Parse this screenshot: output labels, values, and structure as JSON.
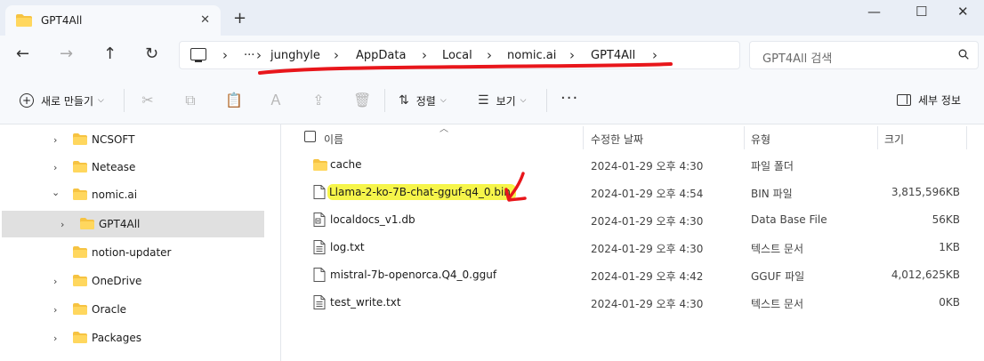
{
  "tab": {
    "title": "GPT4All",
    "close": "✕",
    "new_tab": "+"
  },
  "window_controls": {
    "minimize": "—",
    "maximize": "☐",
    "close": "✕"
  },
  "nav": {
    "back": "←",
    "forward": "→",
    "up": "↑",
    "refresh": "↻"
  },
  "address": {
    "more": "···",
    "separator": "›",
    "crumbs": [
      "junghyle",
      "AppData",
      "Local",
      "nomic.ai",
      "GPT4All"
    ]
  },
  "search": {
    "placeholder": "GPT4All 검색"
  },
  "toolbar": {
    "new_label": "새로 만들기",
    "sort_label": "정렬",
    "view_label": "보기",
    "more": "···",
    "details_label": "세부 정보"
  },
  "sidebar": {
    "items": [
      {
        "label": "NCSOFT",
        "expanded": false
      },
      {
        "label": "Netease",
        "expanded": false
      },
      {
        "label": "nomic.ai",
        "expanded": true
      },
      {
        "label": "GPT4All",
        "expanded": false,
        "selected": true
      },
      {
        "label": "notion-updater",
        "expanded": false
      },
      {
        "label": "OneDrive",
        "expanded": false
      },
      {
        "label": "Oracle",
        "expanded": false
      },
      {
        "label": "Packages",
        "expanded": false
      }
    ]
  },
  "columns": {
    "name": "이름",
    "modified": "수정한 날짜",
    "type": "유형",
    "size": "크기"
  },
  "files": [
    {
      "name": "cache",
      "date": "2024-01-29 오후 4:30",
      "type": "파일 폴더",
      "size": "",
      "icon": "folder-icon"
    },
    {
      "name": "Llama-2-ko-7B-chat-gguf-q4_0.bin",
      "date": "2024-01-29 오후 4:54",
      "type": "BIN 파일",
      "size": "3,815,596KB",
      "icon": "file-icon",
      "highlighted": true
    },
    {
      "name": "localdocs_v1.db",
      "date": "2024-01-29 오후 4:30",
      "type": "Data Base File",
      "size": "56KB",
      "icon": "database-file-icon"
    },
    {
      "name": "log.txt",
      "date": "2024-01-29 오후 4:30",
      "type": "텍스트 문서",
      "size": "1KB",
      "icon": "text-file-icon"
    },
    {
      "name": "mistral-7b-openorca.Q4_0.gguf",
      "date": "2024-01-29 오후 4:42",
      "type": "GGUF 파일",
      "size": "4,012,625KB",
      "icon": "file-icon"
    },
    {
      "name": "test_write.txt",
      "date": "2024-01-29 오후 4:30",
      "type": "텍스트 문서",
      "size": "0KB",
      "icon": "text-file-icon"
    }
  ],
  "colors": {
    "folder": "#f6c342",
    "highlight": "#f6f54a",
    "annotation_red": "#e8161b",
    "selection": "#e0e0e0"
  }
}
